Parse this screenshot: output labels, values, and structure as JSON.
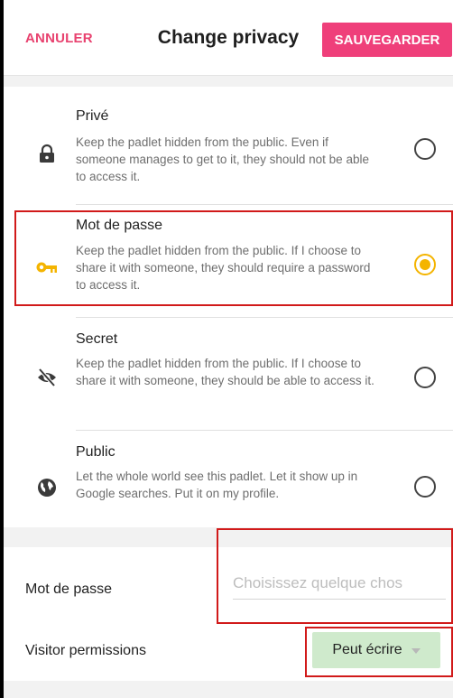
{
  "header": {
    "cancel_label": "ANNULER",
    "title": "Change privacy",
    "save_label": "SAUVEGARDER"
  },
  "options": [
    {
      "name": "Privé",
      "description": "Keep the padlet hidden from the public. Even if someone manages to get to it, they should not be able to access it.",
      "icon": "lock-icon",
      "selected": false
    },
    {
      "name": "Mot de passe",
      "description": "Keep the padlet hidden from the public. If I choose to share it with someone, they should require a password to access it.",
      "icon": "key-icon",
      "selected": true
    },
    {
      "name": "Secret",
      "description": "Keep the padlet hidden from the public. If I choose to share it with someone, they should be able to access it.",
      "icon": "eye-off-icon",
      "selected": false
    },
    {
      "name": "Public",
      "description": "Let the whole world see this padlet. Let it show up in Google searches. Put it on my profile.",
      "icon": "globe-icon",
      "selected": false
    }
  ],
  "password": {
    "label": "Mot de passe",
    "placeholder": "Choisissez quelque chos",
    "value": ""
  },
  "visitor_permissions": {
    "label": "Visitor permissions",
    "selected": "Peut écrire"
  },
  "colors": {
    "accent": "#ef3f7a",
    "cancel": "#e8426f",
    "radio_selected": "#f4b400",
    "key_icon": "#f4b400",
    "permission_bg": "#cfeacc",
    "highlight": "#d11a1a"
  }
}
